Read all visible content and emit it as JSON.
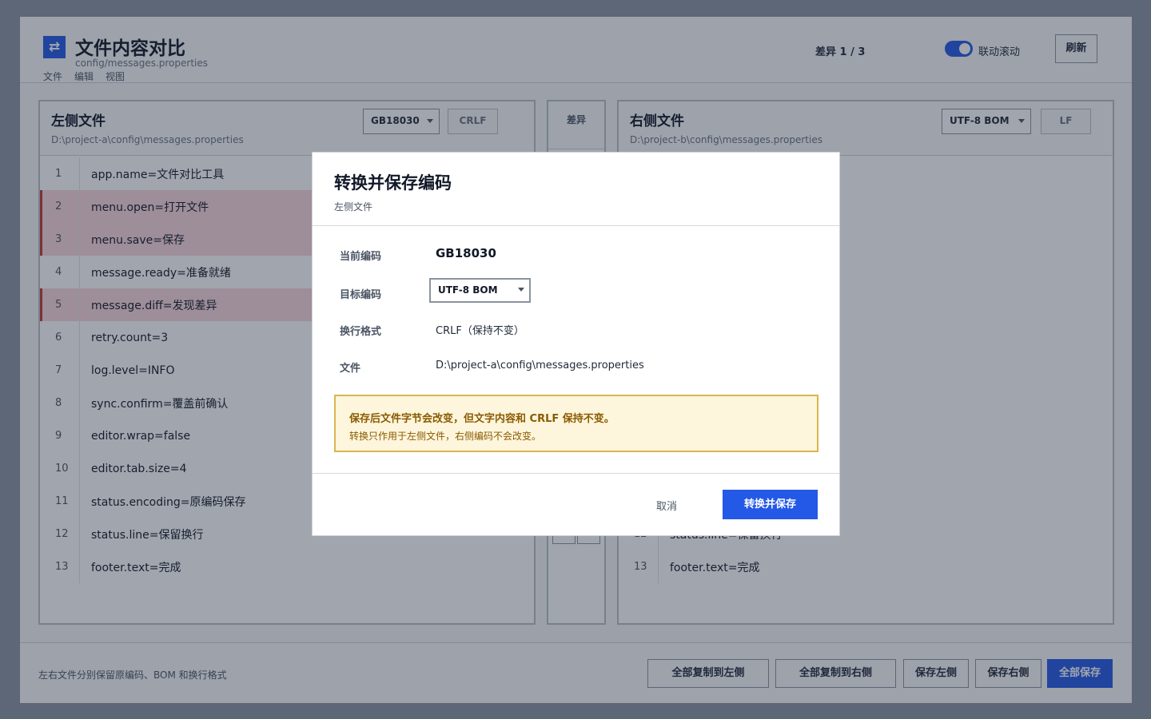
{
  "app": {
    "title": "文件内容对比",
    "path": "config/messages.properties",
    "menu": [
      "文件",
      "编辑",
      "视图"
    ],
    "diff_counter": "差异 1 / 3",
    "sync_scroll_label": "联动滚动",
    "sync_scroll_on": true,
    "refresh_label": "刷新"
  },
  "left": {
    "title": "左侧文件",
    "path": "D:\\project-a\\config\\messages.properties",
    "encoding": "GB18030",
    "eol": "CRLF",
    "lines": [
      {
        "n": "1",
        "text": "app.name=文件对比工具",
        "diff": false
      },
      {
        "n": "2",
        "text": "menu.open=打开文件",
        "diff": true
      },
      {
        "n": "3",
        "text": "menu.save=保存",
        "diff": true
      },
      {
        "n": "4",
        "text": "message.ready=准备就绪",
        "diff": false
      },
      {
        "n": "5",
        "text": "message.diff=发现差异",
        "diff": true
      },
      {
        "n": "6",
        "text": "retry.count=3",
        "diff": false
      },
      {
        "n": "7",
        "text": "log.level=INFO",
        "diff": false
      },
      {
        "n": "8",
        "text": "sync.confirm=覆盖前确认",
        "diff": false
      },
      {
        "n": "9",
        "text": "editor.wrap=false",
        "diff": false
      },
      {
        "n": "10",
        "text": "editor.tab.size=4",
        "diff": false
      },
      {
        "n": "11",
        "text": "status.encoding=原编码保存",
        "diff": false
      },
      {
        "n": "12",
        "text": "status.line=保留换行",
        "diff": false
      },
      {
        "n": "13",
        "text": "footer.text=完成",
        "diff": false
      }
    ]
  },
  "middle": {
    "title": "差异"
  },
  "right": {
    "title": "右侧文件",
    "path": "D:\\project-b\\config\\messages.properties",
    "encoding": "UTF-8 BOM",
    "eol": "LF",
    "lines": [
      {
        "n": "12",
        "text": "status.line=保留换行",
        "diff": false
      },
      {
        "n": "13",
        "text": "footer.text=完成",
        "diff": false
      }
    ]
  },
  "bottom": {
    "note": "左右文件分别保留原编码、BOM 和换行格式",
    "copy_to_left": "全部复制到左侧",
    "copy_to_right": "全部复制到右侧",
    "save_left": "保存左侧",
    "save_right": "保存右侧",
    "save_all": "全部保存"
  },
  "dialog": {
    "title": "转换并保存编码",
    "subtitle": "左侧文件",
    "current_label": "当前编码",
    "current_value": "GB18030",
    "target_label": "目标编码",
    "target_value": "UTF-8 BOM",
    "eol_label": "换行格式",
    "eol_value": "CRLF（保持不变）",
    "file_label": "文件",
    "file_value": "D:\\project-a\\config\\messages.properties",
    "warning_main": "保存后文件字节会改变，但文字内容和 CRLF 保持不变。",
    "warning_sub": "转换只作用于左侧文件，右侧编码不会改变。",
    "cancel_label": "取消",
    "confirm_label": "转换并保存"
  },
  "colors": {
    "accent": "#2458e6",
    "diff_bg": "#f8d7dc",
    "diff_marker": "#c0392b",
    "warning_bg": "#fdf6dc",
    "warning_border": "#d8b64e",
    "warning_text": "#8a5a00"
  }
}
